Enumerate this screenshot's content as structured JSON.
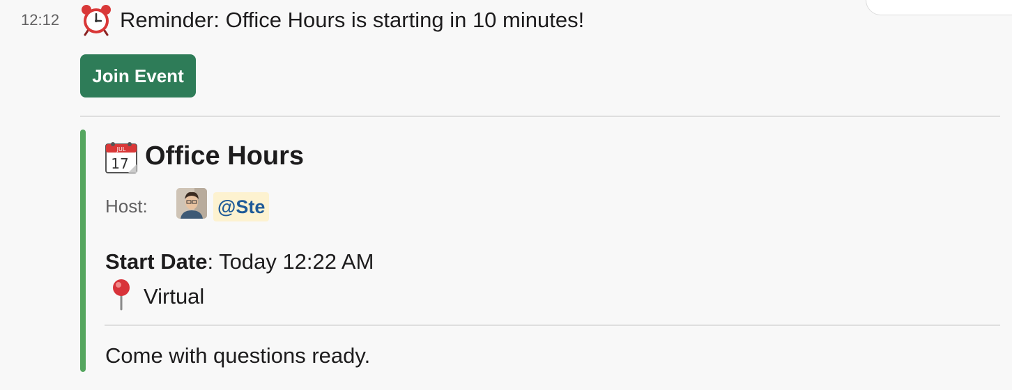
{
  "message": {
    "timestamp": "12:12",
    "alarm_icon": "alarm-clock-icon",
    "reminder_text": "Reminder: Office Hours is starting in 10 minutes!",
    "join_button_label": "Join Event"
  },
  "event": {
    "calendar_icon": "calendar-icon",
    "title": "Office Hours",
    "host_label": "Host:",
    "host_mention": "@Ste",
    "start_date_label": "Start Date",
    "start_date_value": ": Today 12:22 AM",
    "location_icon": "pushpin-icon",
    "location": "Virtual",
    "description": "Come with questions ready."
  },
  "colors": {
    "button": "#2e7c58",
    "accent_bar": "#55a65f",
    "mention_text": "#1e5a98",
    "mention_bg": "#fdf2d0",
    "background": "#f8f8f8"
  }
}
